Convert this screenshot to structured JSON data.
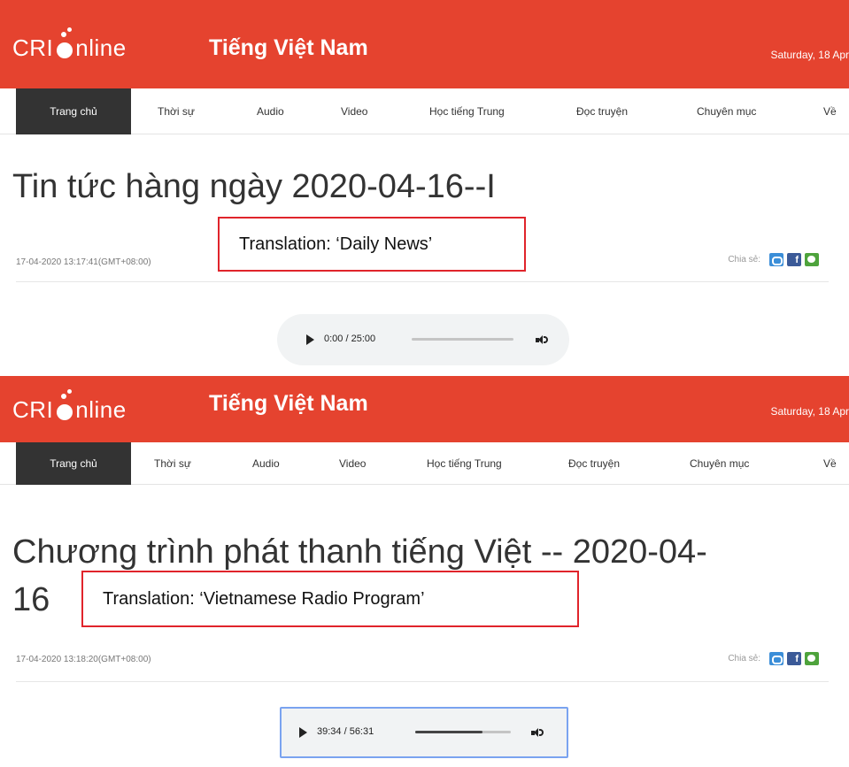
{
  "site": {
    "logo_text": "CRIOnline",
    "logo_part_1": "CRI",
    "logo_part_2": "nline",
    "name": "Tiếng Việt Nam",
    "date": "Saturday, 18 Apr"
  },
  "nav": {
    "items": [
      "Trang chủ",
      "Thời sự",
      "Audio",
      "Video",
      "Học tiếng Trung",
      "Đọc truyện",
      "Chuyên mục",
      "Về"
    ]
  },
  "article_1": {
    "title": "Tin tức hàng ngày 2020-04-16--I",
    "translation": "Translation: ‘Daily News’",
    "timestamp": "17-04-2020 13:17:41(GMT+08:00)",
    "share_label": "Chia sẻ:",
    "player": {
      "time": "0:00 / 25:00",
      "progress": 0.0
    }
  },
  "article_2": {
    "title_line_1": "Chương trình phát thanh tiếng Việt -- 2020-04-",
    "title_line_2": "16",
    "translation": "Translation: ‘Vietnamese Radio Program’",
    "timestamp": "17-04-2020 13:18:20(GMT+08:00)",
    "share_label": "Chia sẻ:",
    "player": {
      "time": "39:34 / 56:31",
      "progress": 0.7
    }
  },
  "colors": {
    "brand_red": "#e5432f",
    "nav_active": "#333333",
    "annotation_red": "#e0242b",
    "selection_blue": "#7aa3f0"
  },
  "icons": [
    "play-icon",
    "volume-icon",
    "weibo-share-icon",
    "facebook-share-icon",
    "wechat-share-icon"
  ]
}
